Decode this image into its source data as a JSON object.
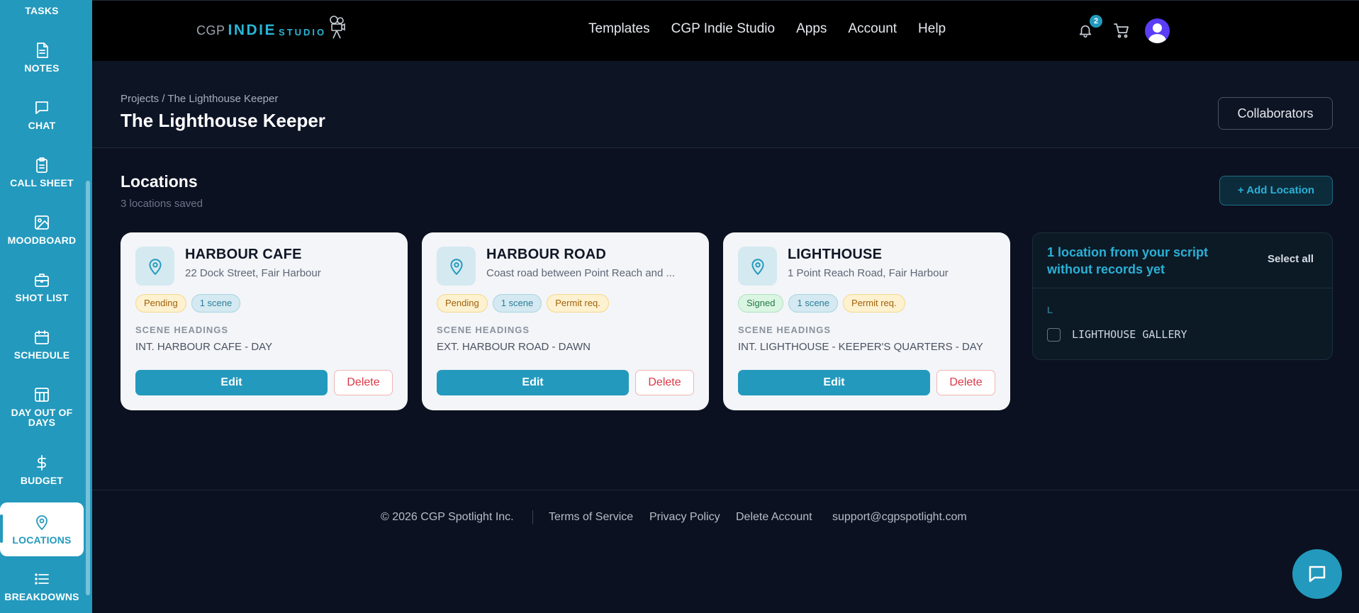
{
  "sidebar": {
    "items": [
      {
        "label": "TASKS",
        "icon": "checklist-icon"
      },
      {
        "label": "NOTES",
        "icon": "document-icon"
      },
      {
        "label": "CHAT",
        "icon": "chat-bubble-icon"
      },
      {
        "label": "CALL SHEET",
        "icon": "clipboard-icon"
      },
      {
        "label": "MOODBOARD",
        "icon": "image-icon"
      },
      {
        "label": "SHOT LIST",
        "icon": "briefcase-icon"
      },
      {
        "label": "SCHEDULE",
        "icon": "calendar-icon"
      },
      {
        "label": "DAY OUT OF DAYS",
        "icon": "grid-table-icon"
      },
      {
        "label": "BUDGET",
        "icon": "dollar-icon"
      },
      {
        "label": "LOCATIONS",
        "icon": "map-pin-icon",
        "active": true
      },
      {
        "label": "BREAKDOWNS",
        "icon": "list-icon"
      }
    ]
  },
  "topnav": {
    "logo": {
      "cgp": "CGP",
      "indie": "INDIE",
      "studio": "STUDIO"
    },
    "links": [
      "Templates",
      "CGP Indie Studio",
      "Apps",
      "Account",
      "Help"
    ],
    "notification_count": "2"
  },
  "header": {
    "breadcrumb": "Projects / The Lighthouse Keeper",
    "title": "The Lighthouse Keeper",
    "collaborators_label": "Collaborators"
  },
  "locations": {
    "title": "Locations",
    "subtitle": "3 locations saved",
    "add_label": "+ Add Location",
    "scene_headings_label": "SCENE HEADINGS",
    "edit_label": "Edit",
    "delete_label": "Delete",
    "cards": [
      {
        "name": "HARBOUR CAFE",
        "address": "22 Dock Street, Fair Harbour",
        "tags": [
          {
            "text": "Pending",
            "kind": "pending"
          },
          {
            "text": "1 scene",
            "kind": "scene"
          }
        ],
        "scene_heading": "INT. HARBOUR CAFE - DAY"
      },
      {
        "name": "HARBOUR ROAD",
        "address": "Coast road between Point Reach and ...",
        "tags": [
          {
            "text": "Pending",
            "kind": "pending"
          },
          {
            "text": "1 scene",
            "kind": "scene"
          },
          {
            "text": "Permit req.",
            "kind": "permit"
          }
        ],
        "scene_heading": "EXT. HARBOUR ROAD - DAWN"
      },
      {
        "name": "LIGHTHOUSE",
        "address": "1 Point Reach Road, Fair Harbour",
        "tags": [
          {
            "text": "Signed",
            "kind": "signed"
          },
          {
            "text": "1 scene",
            "kind": "scene"
          },
          {
            "text": "Permit req.",
            "kind": "permit"
          }
        ],
        "scene_heading": "INT. LIGHTHOUSE - KEEPER'S QUARTERS - DAY"
      }
    ]
  },
  "script_panel": {
    "title": "1 location from your script without records yet",
    "select_all": "Select all",
    "group_letter": "L",
    "items": [
      "LIGHTHOUSE GALLERY"
    ]
  },
  "footer": {
    "copyright": "© 2026 CGP Spotlight Inc.",
    "links": [
      "Terms of Service",
      "Privacy Policy",
      "Delete Account",
      "support@cgpspotlight.com"
    ]
  },
  "colors": {
    "accent": "#2399bd",
    "background": "#0b1120",
    "nav": "#000000"
  }
}
